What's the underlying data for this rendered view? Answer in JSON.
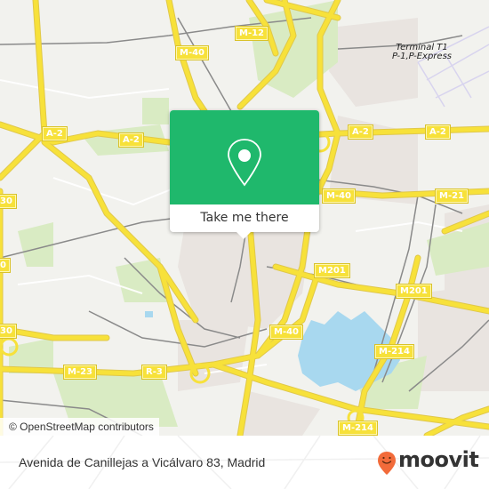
{
  "map": {
    "road_shields": [
      {
        "id": "m40-north",
        "label": "M-40"
      },
      {
        "id": "m12",
        "label": "M-12"
      },
      {
        "id": "a2-west-1",
        "label": "A-2"
      },
      {
        "id": "a2-west-2",
        "label": "A-2"
      },
      {
        "id": "a2-east-1",
        "label": "A-2"
      },
      {
        "id": "a2-east-2",
        "label": "A-2"
      },
      {
        "id": "m40-east",
        "label": "M-40"
      },
      {
        "id": "m21",
        "label": "M-21"
      },
      {
        "id": "m30-a",
        "label": "30"
      },
      {
        "id": "m30-b",
        "label": "0"
      },
      {
        "id": "m30-c",
        "label": "30"
      },
      {
        "id": "m201-a",
        "label": "M201"
      },
      {
        "id": "m201-b",
        "label": "M201"
      },
      {
        "id": "m40-south",
        "label": "M-40"
      },
      {
        "id": "m214-a",
        "label": "M-214"
      },
      {
        "id": "m214-b",
        "label": "M-214"
      },
      {
        "id": "m23",
        "label": "M-23"
      },
      {
        "id": "r3",
        "label": "R-3"
      }
    ],
    "place_label": {
      "line1": "Terminal T1",
      "line2": "P-1,P-Express"
    },
    "colors": {
      "road": "#f7e13a",
      "water": "#a8d8ef",
      "park": "#d8ebc0",
      "urban": "#e8e2de",
      "rail": "#888888",
      "popup_accent": "#1fb86c"
    }
  },
  "popup": {
    "icon": "map-pin-icon",
    "button_label": "Take me there"
  },
  "attribution": "© OpenStreetMap contributors",
  "footer": {
    "address": "Avenida de Canillejas a Vicálvaro 83, Madrid",
    "brand": "moovit",
    "brand_color": "#f26b3a"
  }
}
